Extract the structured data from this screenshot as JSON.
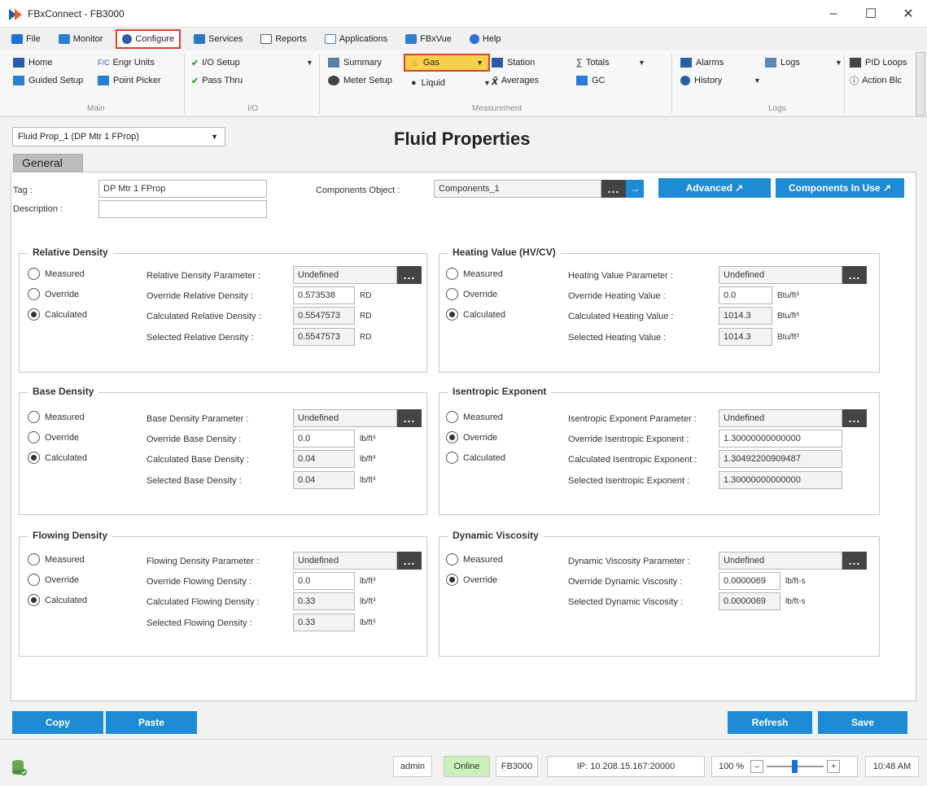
{
  "window": {
    "title": "FBxConnect - FB3000",
    "min": "–",
    "max": "☐",
    "close": "✕"
  },
  "menu": [
    {
      "label": "File",
      "color": "#1e6fd6"
    },
    {
      "label": "Monitor",
      "color": "#2f7fd0"
    },
    {
      "label": "Configure",
      "color": "#2d5fa3"
    },
    {
      "label": "Services",
      "color": "#2e77c7"
    },
    {
      "label": "Reports",
      "color": "#555555"
    },
    {
      "label": "Applications",
      "color": "#2c7fd6"
    },
    {
      "label": "FBxVue",
      "color": "#2f7fd0"
    },
    {
      "label": "Help",
      "color": "#2e6fd0"
    }
  ],
  "ribbon": {
    "home": "Home",
    "guided_setup": "Guided Setup",
    "engr_units": "Engr Units",
    "engr_prefix": "F/C",
    "point_picker": "Point Picker",
    "group_main": "Main",
    "io_setup": "I/O Setup",
    "pass_thru": "Pass Thru",
    "group_io": "I/O",
    "summary": "Summary",
    "meter_setup": "Meter Setup",
    "gas": "Gas",
    "liquid": "Liquid",
    "station": "Station",
    "averages": "Averages",
    "totals": "Totals",
    "gc": "GC",
    "group_measurement": "Measurement",
    "alarms": "Alarms",
    "history": "History",
    "logs": "Logs",
    "group_logs": "Logs",
    "pid_loops": "PID Loops",
    "action_blocks": "Action Blc"
  },
  "object_select": "Fluid Prop_1 (DP Mtr 1 FProp)",
  "page_title": "Fluid Properties",
  "tab_general": "General",
  "general": {
    "tag_label": "Tag :",
    "tag_value": "DP Mtr 1 FProp",
    "desc_label": "Description :",
    "desc_value": "",
    "components_label": "Components Object :",
    "components_value": "Components_1",
    "advanced": "Advanced ↗",
    "components_in_use": "Components In Use ↗"
  },
  "radio": {
    "measured": "Measured",
    "override": "Override",
    "calculated": "Calculated"
  },
  "ellipsis": "...",
  "relative_density": {
    "title": "Relative Density",
    "param_label": "Relative Density Parameter :",
    "param_value": "Undefined",
    "override_label": "Override Relative Density :",
    "override_value": "0.573538",
    "override_unit": "RD",
    "calc_label": "Calculated Relative Density :",
    "calc_value": "0.5547573",
    "calc_unit": "RD",
    "sel_label": "Selected Relative Density :",
    "sel_value": "0.5547573",
    "sel_unit": "RD"
  },
  "heating_value": {
    "title": "Heating Value (HV/CV)",
    "param_label": "Heating Value Parameter :",
    "param_value": "Undefined",
    "override_label": "Override Heating Value :",
    "override_value": "0.0",
    "override_unit": "Btu/ft³",
    "calc_label": "Calculated Heating Value :",
    "calc_value": "1014.3",
    "calc_unit": "Btu/ft³",
    "sel_label": "Selected Heating Value :",
    "sel_value": "1014.3",
    "sel_unit": "Btu/ft³"
  },
  "base_density": {
    "title": "Base Density",
    "param_label": "Base Density Parameter :",
    "param_value": "Undefined",
    "override_label": "Override Base Density :",
    "override_value": "0.0",
    "override_unit": "lb/ft³",
    "calc_label": "Calculated Base Density :",
    "calc_value": "0.04",
    "calc_unit": "lb/ft³",
    "sel_label": "Selected Base Density :",
    "sel_value": "0.04",
    "sel_unit": "lb/ft³"
  },
  "isentropic": {
    "title": "Isentropic Exponent",
    "param_label": "Isentropic Exponent Parameter :",
    "param_value": "Undefined",
    "override_label": "Override Isentropic Exponent :",
    "override_value": "1.30000000000000",
    "calc_label": "Calculated Isentropic Exponent :",
    "calc_value": "1.30492200909487",
    "sel_label": "Selected Isentropic Exponent :",
    "sel_value": "1.30000000000000"
  },
  "flowing_density": {
    "title": "Flowing Density",
    "param_label": "Flowing Density Parameter :",
    "param_value": "Undefined",
    "override_label": "Override Flowing Density :",
    "override_value": "0.0",
    "override_unit": "lb/ft³",
    "calc_label": "Calculated Flowing Density :",
    "calc_value": "0.33",
    "calc_unit": "lb/ft³",
    "sel_label": "Selected Flowing Density :",
    "sel_value": "0.33",
    "sel_unit": "lb/ft³"
  },
  "dynamic_viscosity": {
    "title": "Dynamic Viscosity",
    "param_label": "Dynamic Viscosity Parameter :",
    "param_value": "Undefined",
    "override_label": "Override Dynamic Viscosity :",
    "override_value": "0.0000069",
    "override_unit": "lb/ft-s",
    "sel_label": "Selected Dynamic Viscosity :",
    "sel_value": "0.0000069",
    "sel_unit": "lb/ft-s"
  },
  "buttons": {
    "copy": "Copy",
    "paste": "Paste",
    "refresh": "Refresh",
    "save": "Save"
  },
  "status": {
    "user": "admin",
    "online": "Online",
    "device": "FB3000",
    "ip": "IP: 10.208.15.167:20000",
    "zoom": "100 %",
    "zoom_minus": "–",
    "zoom_plus": "+",
    "time": "10:48 AM"
  },
  "colors": {
    "accent_blue": "#1e8bd6",
    "highlight_red": "#d9412b",
    "gas_yellow": "#f7d14c",
    "online_green": "#c9f0b8"
  }
}
